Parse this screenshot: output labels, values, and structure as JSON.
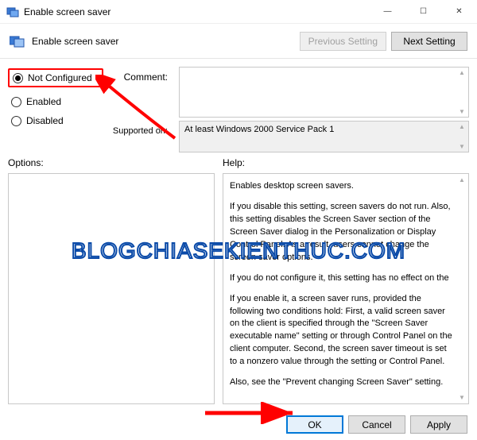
{
  "window": {
    "title": "Enable screen saver",
    "minimize_glyph": "—",
    "maximize_glyph": "☐",
    "close_glyph": "✕"
  },
  "header": {
    "policy_name": "Enable screen saver",
    "previous_setting_label": "Previous Setting",
    "next_setting_label": "Next Setting"
  },
  "state": {
    "not_configured_label": "Not Configured",
    "enabled_label": "Enabled",
    "disabled_label": "Disabled",
    "selected": "not_configured"
  },
  "fields": {
    "comment_label": "Comment:",
    "comment_value": "",
    "supported_label": "Supported on:",
    "supported_value": "At least Windows 2000 Service Pack 1"
  },
  "sections": {
    "options_label": "Options:",
    "help_label": "Help:"
  },
  "help": {
    "p1": "Enables desktop screen savers.",
    "p2": "If you disable this setting, screen savers do not run. Also, this setting disables the Screen Saver section of the Screen Saver dialog in the Personalization or Display Control Panel. As a result, users cannot change the screen saver options.",
    "p3": "If you do not configure it, this setting has no effect on the",
    "p4": "If you enable it, a screen saver runs, provided the following two conditions hold: First, a valid screen saver on the client is specified through the \"Screen Saver executable name\" setting or through Control Panel on the client computer. Second, the screen saver timeout is set to a nonzero value through the setting or Control Panel.",
    "p5": "Also, see the \"Prevent changing Screen Saver\" setting."
  },
  "footer": {
    "ok_label": "OK",
    "cancel_label": "Cancel",
    "apply_label": "Apply"
  },
  "watermark": "BLOGCHIASEKIENTHUC.COM"
}
